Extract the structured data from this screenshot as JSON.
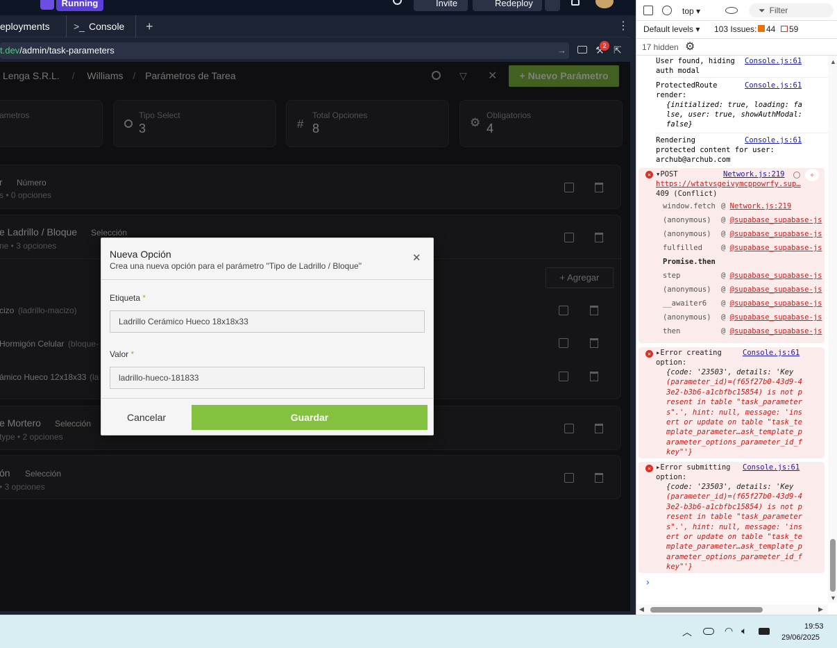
{
  "topbar": {
    "run_label": "Running",
    "invite_label": "Invite",
    "redeploy_label": "Redeploy"
  },
  "tabs": [
    {
      "label": "eployments"
    },
    {
      "label": "Console"
    }
  ],
  "url": {
    "host": "t.dev",
    "path": "/admin/task-parameters"
  },
  "devtools_badge": "2",
  "breadcrumb": {
    "org": "Lenga S.R.L.",
    "sep1": "/",
    "project": "Williams",
    "sep2": "/",
    "page": "Parámetros de Tarea"
  },
  "new_button_label": "+ Nuevo Parámetro",
  "stats": [
    {
      "label": "ametros",
      "value": ""
    },
    {
      "label": "Tipo Select",
      "value": "3"
    },
    {
      "label": "Total Opciones",
      "value": "8"
    },
    {
      "label": "Obligatorios",
      "value": "4"
    }
  ],
  "params": [
    {
      "name": "r",
      "type": "Número",
      "meta": "s • 0 opciones"
    },
    {
      "name": "e Ladrillo / Bloque",
      "type": "Selección",
      "meta": "ne • 3 opciones"
    },
    {
      "name": "e Mortero",
      "type": "Selección",
      "meta": "type • 2 opciones"
    },
    {
      "name": "ón",
      "type": "Selección",
      "meta": "• 3 opciones"
    }
  ],
  "options": [
    {
      "label": "cizo",
      "value": "(ladrillo-macizo)"
    },
    {
      "label": "Hormigón Celular",
      "value": "(bloque-"
    },
    {
      "label": "ámico Hueco 12x18x33",
      "value": "(la"
    }
  ],
  "add_option_label": "+ Agregar",
  "modal": {
    "title": "Nueva Opción",
    "subtitle": "Crea una nueva opción para el parámetro \"Tipo de Ladrillo / Bloque\"",
    "label_field": "Etiqueta",
    "label_value": "Ladrillo Cerámico Hueco 18x18x33",
    "value_field": "Valor",
    "value_value": "ladrillo-hueco-181833",
    "required_mark": "*",
    "cancel": "Cancelar",
    "save": "Guardar"
  },
  "devtools": {
    "context": "top ▾",
    "filter_placeholder": "Filter",
    "levels": "Default levels ▾",
    "issues_label": "103 Issues:",
    "issues_warn": "44",
    "issues_info": "59",
    "hidden": "17 hidden",
    "log1": [
      "User found, hiding",
      "auth modal"
    ],
    "log1_src": "Console.js:61",
    "log2": [
      "ProtectedRoute",
      "render:"
    ],
    "log2_src": "Console.js:61",
    "log2_obj": [
      "{initialized: true, loading: fa",
      "lse, user: true, showAuthModal:",
      "false}"
    ],
    "log3": [
      "Rendering",
      "protected content for user:",
      "archub@archub.com"
    ],
    "log3_src": "Console.js:61",
    "post": "▾POST",
    "post_src": "Network.js:219",
    "post_url": "https://wtatvsgeivymcppowrfy.sup…",
    "post_status": "409 (Conflict)",
    "stack": [
      {
        "fn": "window.fetch",
        "src": "Network.js:219"
      },
      {
        "fn": "(anonymous)",
        "src": "@supabase_supabase-js"
      },
      {
        "fn": "(anonymous)",
        "src": "@supabase_supabase-js"
      },
      {
        "fn": "fulfilled",
        "src": "@supabase_supabase-js"
      },
      {
        "fn": "Promise.then",
        "src": ""
      },
      {
        "fn": "step",
        "src": "@supabase_supabase-js"
      },
      {
        "fn": "(anonymous)",
        "src": "@supabase_supabase-js"
      },
      {
        "fn": "__awaiter6",
        "src": "@supabase_supabase-js"
      },
      {
        "fn": "(anonymous)",
        "src": "@supabase_supabase-js"
      },
      {
        "fn": "then",
        "src": "@supabase_supabase-js"
      }
    ],
    "err1_title": [
      "▸Error creating",
      "option:"
    ],
    "err1_src": "Console.js:61",
    "err2_title": [
      "▸Error submitting",
      "option:"
    ],
    "err2_src": "Console.js:61",
    "err_body": [
      "{code: '23503', details: 'Key",
      "(parameter_id)=(f65f27b0-43d9-4",
      "3e2-b3b6-a1cbfbc15854) is not p",
      "resent in table \"task_parameter",
      "s\".', hint: null, message: 'ins",
      "ert or update on table \"task_te",
      "mplate_parameter…ask_template_p",
      "arameter_options_parameter_id_f",
      "key\"'}"
    ],
    "prompt": "›"
  },
  "clock": {
    "time": "19:53",
    "date": "29/06/2025"
  }
}
